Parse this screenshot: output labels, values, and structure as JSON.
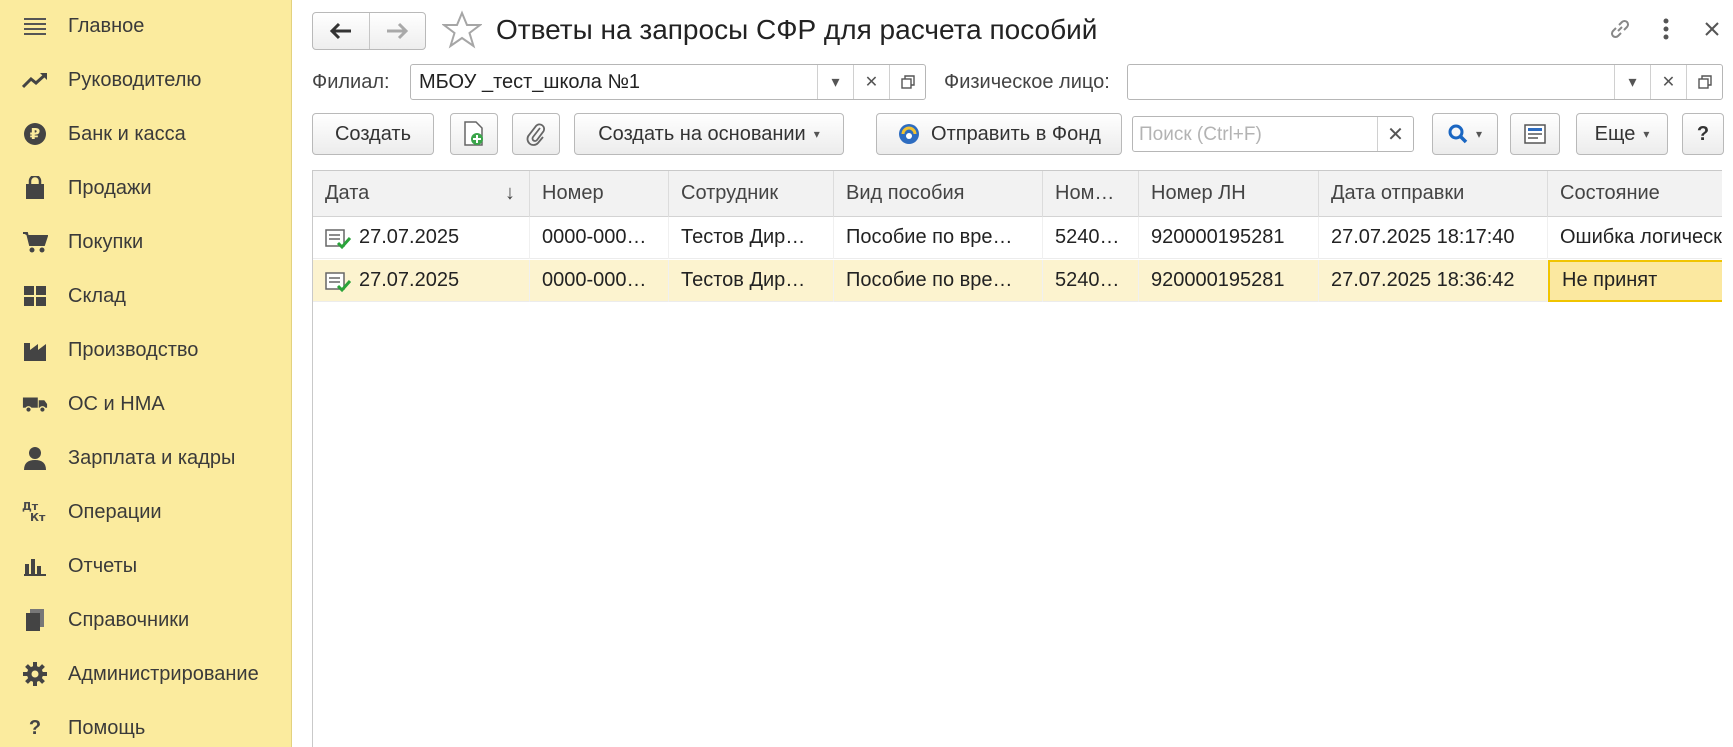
{
  "sidebar": {
    "items": [
      {
        "label": "Главное",
        "icon": "menu-icon"
      },
      {
        "label": "Руководителю",
        "icon": "trend-icon"
      },
      {
        "label": "Банк и касса",
        "icon": "ruble-icon"
      },
      {
        "label": "Продажи",
        "icon": "shopping-bag-icon"
      },
      {
        "label": "Покупки",
        "icon": "cart-icon"
      },
      {
        "label": "Склад",
        "icon": "warehouse-icon"
      },
      {
        "label": "Производство",
        "icon": "factory-icon"
      },
      {
        "label": "ОС и НМА",
        "icon": "truck-icon"
      },
      {
        "label": "Зарплата и кадры",
        "icon": "person-icon"
      },
      {
        "label": "Операции",
        "icon": "debit-credit-icon",
        "glyph_top": "Дт",
        "glyph_bottom": "Кт"
      },
      {
        "label": "Отчеты",
        "icon": "bar-chart-icon"
      },
      {
        "label": "Справочники",
        "icon": "books-icon"
      },
      {
        "label": "Администрирование",
        "icon": "gear-icon"
      },
      {
        "label": "Помощь",
        "icon": "question-icon",
        "glyph": "?"
      }
    ]
  },
  "header": {
    "title": "Ответы на запросы СФР для расчета пособий"
  },
  "filters": {
    "branch_label": "Филиал:",
    "branch_value": "МБОУ _тест_школа №1",
    "person_label": "Физическое лицо:",
    "person_value": ""
  },
  "toolbar": {
    "create_label": "Создать",
    "create_based_label": "Создать на основании",
    "send_label": "Отправить в Фонд",
    "search_placeholder": "Поиск (Ctrl+F)",
    "more_label": "Еще",
    "help_label": "?"
  },
  "table": {
    "columns": [
      "Дата",
      "Номер",
      "Сотрудник",
      "Вид пособия",
      "Ном…",
      "Номер ЛН",
      "Дата отправки",
      "Состояние"
    ],
    "sort_indicator": "↓",
    "rows": [
      {
        "date": "27.07.2025",
        "number": "0000-000…",
        "employee": "Тестов Дир…",
        "benefit": "Пособие по вре…",
        "num2": "5240…",
        "ln": "920000195281",
        "sent": "27.07.2025 18:17:40",
        "status": "Ошибка логического контроля"
      },
      {
        "date": "27.07.2025",
        "number": "0000-000…",
        "employee": "Тестов Дир…",
        "benefit": "Пособие по вре…",
        "num2": "5240…",
        "ln": "920000195281",
        "sent": "27.07.2025 18:36:42",
        "status": "Не принят"
      }
    ]
  },
  "colors": {
    "sidebar_bg": "#fbeb9e",
    "selected_row": "#fcf3cf",
    "active_cell_border": "#f0c400",
    "search_icon": "#1a66c2"
  }
}
